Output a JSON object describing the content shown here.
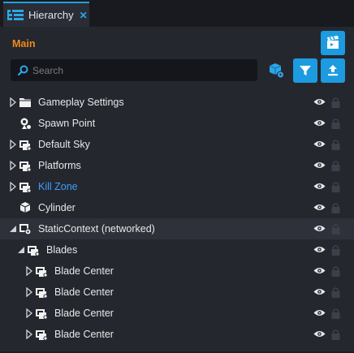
{
  "tab": {
    "label": "Hierarchy",
    "close_glyph": "✕"
  },
  "context_name": "Main",
  "search": {
    "placeholder": "Search",
    "value": ""
  },
  "colors": {
    "accent": "#1c9be0",
    "context": "#f08a1c",
    "highlight": "#3aa0ff"
  },
  "toolbar": {
    "top_button_icon": "clapperboard-icon",
    "filter_icon": "filter-icon",
    "collapse_icon": "upload-icon",
    "object_icon": "cube-object-icon"
  },
  "tree": [
    {
      "label": "Gameplay Settings",
      "depth": 0,
      "expander": "collapsed",
      "icon": "folder-icon",
      "highlight": false,
      "selected": false
    },
    {
      "label": "Spawn Point",
      "depth": 0,
      "expander": "none",
      "icon": "spawn-point-icon",
      "highlight": false,
      "selected": false
    },
    {
      "label": "Default Sky",
      "depth": 0,
      "expander": "collapsed",
      "icon": "group-icon",
      "highlight": false,
      "selected": false
    },
    {
      "label": "Platforms",
      "depth": 0,
      "expander": "collapsed",
      "icon": "group-icon",
      "highlight": false,
      "selected": false
    },
    {
      "label": "Kill Zone",
      "depth": 0,
      "expander": "collapsed",
      "icon": "group-icon",
      "highlight": true,
      "selected": false
    },
    {
      "label": "Cylinder",
      "depth": 0,
      "expander": "none",
      "icon": "cube-icon",
      "highlight": false,
      "selected": false
    },
    {
      "label": "StaticContext (networked)",
      "depth": 0,
      "expander": "expanded",
      "icon": "context-icon",
      "highlight": false,
      "selected": true
    },
    {
      "label": "Blades",
      "depth": 1,
      "expander": "expanded",
      "icon": "group-icon",
      "highlight": false,
      "selected": false
    },
    {
      "label": "Blade Center",
      "depth": 2,
      "expander": "collapsed",
      "icon": "group-icon",
      "highlight": false,
      "selected": false
    },
    {
      "label": "Blade Center",
      "depth": 2,
      "expander": "collapsed",
      "icon": "group-icon",
      "highlight": false,
      "selected": false
    },
    {
      "label": "Blade Center",
      "depth": 2,
      "expander": "collapsed",
      "icon": "group-icon",
      "highlight": false,
      "selected": false
    },
    {
      "label": "Blade Center",
      "depth": 2,
      "expander": "collapsed",
      "icon": "group-icon",
      "highlight": false,
      "selected": false
    }
  ]
}
